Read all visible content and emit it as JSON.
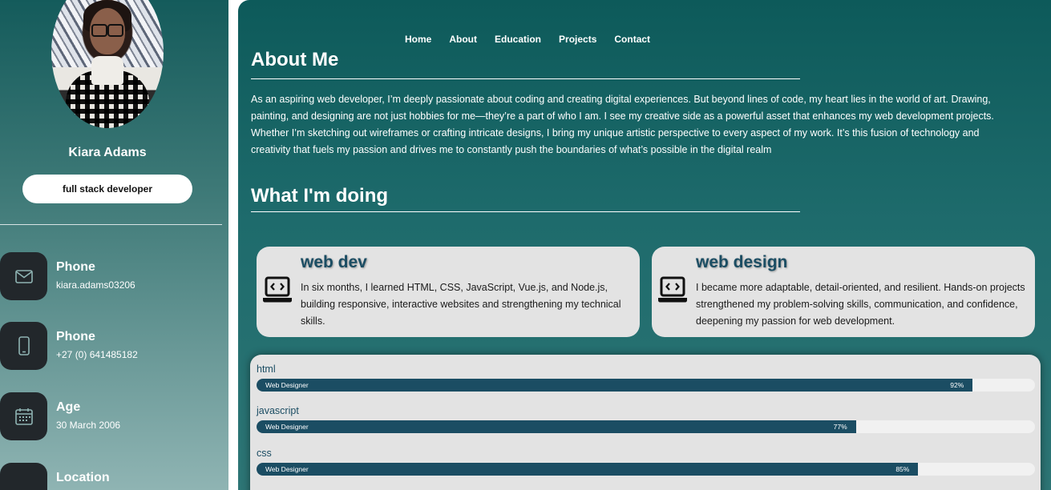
{
  "profile": {
    "name": "Kiara Adams",
    "role": "full stack developer"
  },
  "contacts": [
    {
      "title": "Phone",
      "value": "kiara.adams03206",
      "icon": "mail-icon"
    },
    {
      "title": "Phone",
      "value": "+27 (0) 641485182",
      "icon": "mobile-phone-icon"
    },
    {
      "title": "Age",
      "value": "30 March 2006",
      "icon": "calendar-icon"
    },
    {
      "title": "Location",
      "value": "",
      "icon": "location-pin-icon"
    }
  ],
  "nav": {
    "items": [
      "Home",
      "About",
      "Education",
      "Projects",
      "Contact"
    ]
  },
  "about": {
    "title": "About Me",
    "text": "As an aspiring web developer, I’m deeply passionate about coding and creating digital experiences. But beyond lines of code, my heart lies in the world of art. Drawing, painting, and designing are not just hobbies for me—they’re a part of who I am. I see my creative side as a powerful asset that enhances my web development projects. Whether I’m sketching out wireframes or crafting intricate designs, I bring my unique artistic perspective to every aspect of my work. It’s this fusion of technology and creativity that fuels my passion and drives me to constantly push the boundaries of what’s possible in the digital realm"
  },
  "doing": {
    "title": "What I'm doing",
    "services": [
      {
        "title": "web dev",
        "desc": "In six months, I learned HTML, CSS, JavaScript, Vue.js, and Node.js, building responsive, interactive websites and strengthening my technical skills.",
        "icon": "laptop-code-icon"
      },
      {
        "title": "web design",
        "desc": "I became more adaptable, detail-oriented, and resilient. Hands-on projects strengthened my problem-solving skills, communication, and confidence, deepening my passion for web development.",
        "icon": "laptop-code-icon"
      }
    ]
  },
  "skills": [
    {
      "name": "html",
      "label": "Web Designer",
      "percent": 92,
      "percent_text": "92%"
    },
    {
      "name": "javascript",
      "label": "Web Designer",
      "percent": 77,
      "percent_text": "77%"
    },
    {
      "name": "css",
      "label": "Web Designer",
      "percent": 85,
      "percent_text": "85%"
    }
  ],
  "colors": {
    "sidebar_top": "#145b5b",
    "main_bg": "#0d5a5a",
    "accent": "#1b4d63",
    "card_bg": "#e3e3e3",
    "icon_tile": "#22272b"
  }
}
